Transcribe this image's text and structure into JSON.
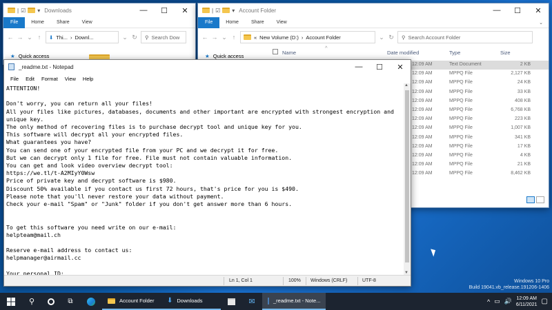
{
  "explorer_left": {
    "title": "Downloads",
    "tabs": [
      "File",
      "Home",
      "Share",
      "View"
    ],
    "path": [
      "Thi...",
      "Downl..."
    ],
    "search_placeholder": "Search Dow",
    "quick_access": "Quick access"
  },
  "explorer_right": {
    "title": "Account Folder",
    "tabs": [
      "File",
      "Home",
      "Share",
      "View"
    ],
    "path_prefix": "«",
    "path": [
      "New Volume (D:)",
      "Account Folder"
    ],
    "search_placeholder": "Search Account Folder",
    "quick_access": "Quick access",
    "columns": [
      "Name",
      "Date modified",
      "Type",
      "Size"
    ],
    "rows": [
      {
        "time": "12:09 AM",
        "type": "Text Document",
        "size": "2 KB"
      },
      {
        "time": "12:09 AM",
        "type": "MPPQ File",
        "size": "2,127 KB"
      },
      {
        "time": "12:09 AM",
        "type": "MPPQ File",
        "size": "24 KB"
      },
      {
        "time": "12:09 AM",
        "type": "MPPQ File",
        "size": "33 KB"
      },
      {
        "time": "12:09 AM",
        "type": "MPPQ File",
        "size": "408 KB"
      },
      {
        "time": "12:09 AM",
        "type": "MPPQ File",
        "size": "6,768 KB"
      },
      {
        "time": "12:09 AM",
        "type": "MPPQ File",
        "size": "223 KB"
      },
      {
        "time": "12:09 AM",
        "type": "MPPQ File",
        "size": "1,007 KB"
      },
      {
        "time": "12:09 AM",
        "type": "MPPQ File",
        "size": "341 KB"
      },
      {
        "time": "12:09 AM",
        "type": "MPPQ File",
        "size": "17 KB"
      },
      {
        "time": "12:09 AM",
        "type": "MPPQ File",
        "size": "4 KB"
      },
      {
        "time": "12:09 AM",
        "type": "MPPQ File",
        "size": "21 KB"
      },
      {
        "time": "12:09 AM",
        "type": "MPPQ File",
        "size": "8,462 KB"
      }
    ]
  },
  "notepad": {
    "title": "_readme.txt - Notepad",
    "menu": [
      "File",
      "Edit",
      "Format",
      "View",
      "Help"
    ],
    "content": "ATTENTION!\n\nDon't worry, you can return all your files!\nAll your files like pictures, databases, documents and other important are encrypted with strongest encryption and unique key.\nThe only method of recovering files is to purchase decrypt tool and unique key for you.\nThis software will decrypt all your encrypted files.\nWhat guarantees you have?\nYou can send one of your encrypted file from your PC and we decrypt it for free.\nBut we can decrypt only 1 file for free. File must not contain valuable information.\nYou can get and look video overview decrypt tool:\nhttps://we.tl/t-A2MIyY0Wsw\nPrice of private key and decrypt software is $980.\nDiscount 50% available if you contact us first 72 hours, that's price for you is $490.\nPlease note that you'll never restore your data without payment.\nCheck your e-mail \"Spam\" or \"Junk\" folder if you don't get answer more than 6 hours.\n\n\nTo get this software you need write on our e-mail:\nhelpteam@mail.ch\n\nReserve e-mail address to contact us:\nhelpmanager@airmail.cc\n\nYour personal ID:",
    "status": {
      "position": "Ln 1, Col 1",
      "zoom": "100%",
      "eol": "Windows (CRLF)",
      "encoding": "UTF-8"
    }
  },
  "watermark": {
    "line1": "Windows 10 Pro",
    "line2": "Build 19041.vb_release.191206-1406"
  },
  "taskbar": {
    "apps": [
      "Account Folder",
      "Downloads",
      "_readme.txt - Note..."
    ],
    "time": "12:09 AM",
    "date": "6/11/2021"
  },
  "colors": {
    "accent": "#1979ca",
    "taskbar": "#1c2430",
    "selection": "#dcdcdc"
  }
}
